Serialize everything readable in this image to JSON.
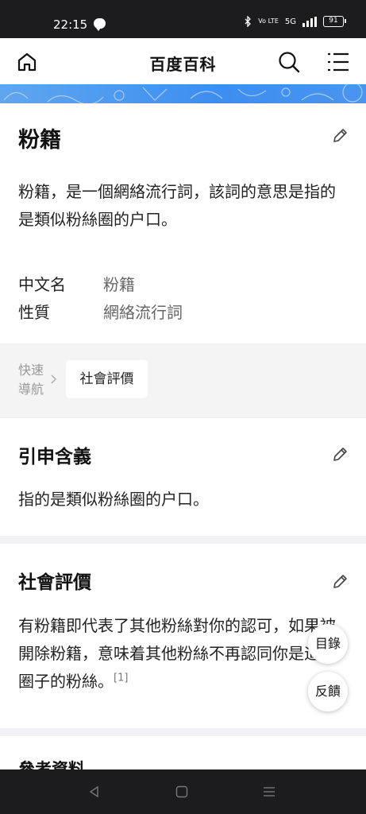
{
  "status_bar": {
    "time": "22:15",
    "network": "5G",
    "volte": "Vo LTE",
    "battery": "91"
  },
  "header": {
    "title": "百度百科"
  },
  "entry": {
    "title": "粉籍",
    "summary": "粉籍，是一個網絡流行詞，該詞的意思是指的是類似粉絲圈的户口。",
    "info": [
      {
        "key": "中文名",
        "value": "粉籍"
      },
      {
        "key": "性質",
        "value": "網絡流行詞"
      }
    ]
  },
  "quick_nav": {
    "label": "快速導航",
    "items": [
      "社會評價"
    ]
  },
  "sections": [
    {
      "title": "引申含義",
      "body": "指的是類似粉絲圈的户口。"
    },
    {
      "title": "社會評價",
      "body": "有粉籍即代表了其他粉絲對你的認可，如果被開除粉籍，意味着其他粉絲不再認同你是這個圈子的粉絲。",
      "ref": "[1]"
    }
  ],
  "references": {
    "title": "參考資料"
  },
  "floating": {
    "toc": "目錄",
    "feedback": "反饋"
  },
  "accent_color": "#4a95ee"
}
